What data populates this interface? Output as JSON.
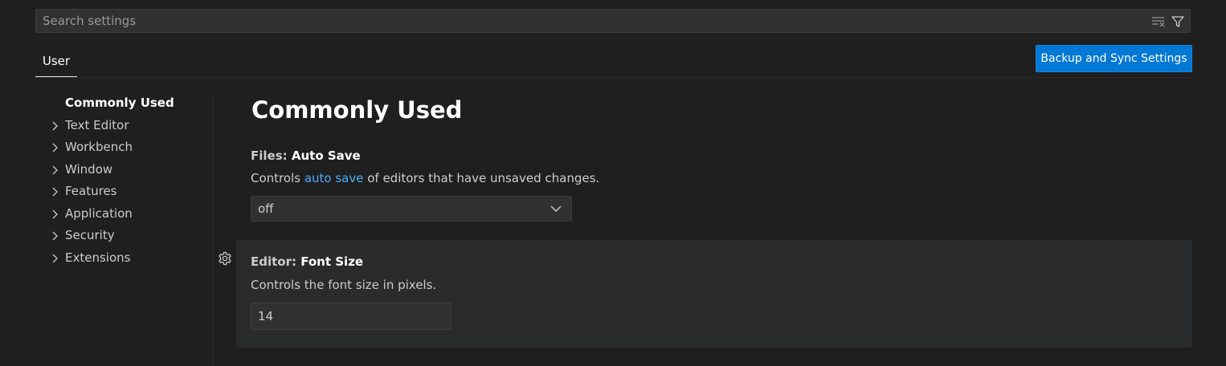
{
  "search": {
    "placeholder": "Search settings",
    "value": "",
    "icons": [
      "clear-filter-icon",
      "filter-icon"
    ]
  },
  "tabs": [
    {
      "label": "User",
      "active": true
    }
  ],
  "sync_button": {
    "label": "Backup and Sync Settings"
  },
  "toc": {
    "items": [
      {
        "label": "Commonly Used",
        "active": true,
        "expandable": false
      },
      {
        "label": "Text Editor",
        "expandable": true
      },
      {
        "label": "Workbench",
        "expandable": true
      },
      {
        "label": "Window",
        "expandable": true
      },
      {
        "label": "Features",
        "expandable": true
      },
      {
        "label": "Application",
        "expandable": true
      },
      {
        "label": "Security",
        "expandable": true
      },
      {
        "label": "Extensions",
        "expandable": true
      }
    ]
  },
  "main": {
    "heading": "Commonly Used",
    "settings": [
      {
        "category": "Files: ",
        "name": "Auto Save",
        "desc_before": "Controls ",
        "desc_link": "auto save",
        "desc_after": " of editors that have unsaved changes.",
        "control": "select",
        "value": "off"
      },
      {
        "category": "Editor: ",
        "name": "Font Size",
        "description": "Controls the font size in pixels.",
        "control": "number",
        "value": "14",
        "gear_icon": "gear-icon"
      }
    ]
  },
  "colors": {
    "background": "#1f1f1f",
    "accent": "#0078d4",
    "link": "#4daafc",
    "focused_row": "#2a2b2d"
  }
}
